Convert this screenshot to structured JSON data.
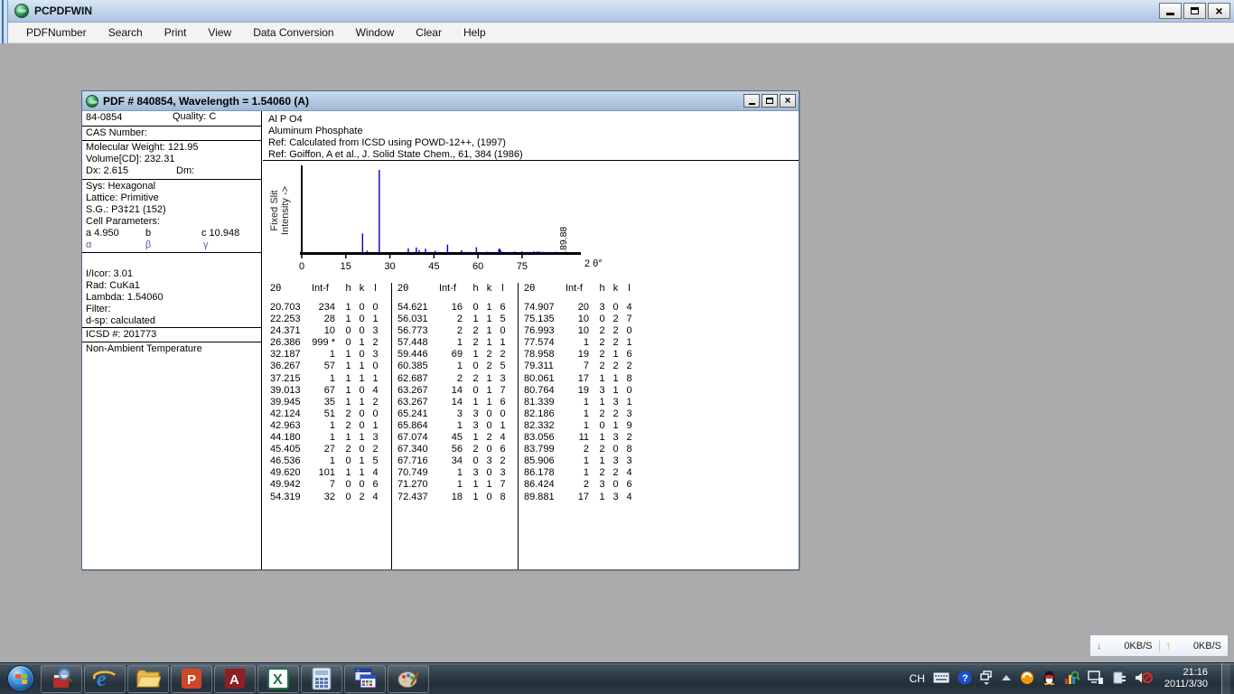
{
  "app": {
    "title": "PCPDFWIN",
    "menu": [
      "PDFNumber",
      "Search",
      "Print",
      "View",
      "Data Conversion",
      "Window",
      "Clear",
      "Help"
    ],
    "window_controls": [
      "minimize",
      "maximize",
      "close"
    ]
  },
  "card_window": {
    "title": "PDF # 840854,  Wavelength = 1.54060   (A)",
    "left_panel": {
      "pdf_number": "84-0854",
      "quality": "Quality: C",
      "cas": "CAS Number:",
      "molecular_weight": "Molecular Weight:   121.95",
      "volume": "Volume[CD]:    232.31",
      "dx": "Dx:  2.615",
      "dm": "Dm:",
      "sys": "Sys: Hexagonal",
      "lattice": "Lattice: Primitive",
      "sg": "S.G.: P3‡21 (152)",
      "cell_parameters": "Cell Parameters:",
      "a": "a  4.950",
      "b": "b",
      "c": "c  10.948",
      "alpha": "α",
      "beta": "β",
      "gamma": "γ",
      "i_icor": "I/Icor:   3.01",
      "rad": "Rad: CuKa1",
      "lambda": "Lambda: 1.54060",
      "filter": "Filter:",
      "d_sp": "d-sp: calculated",
      "icsd": "ICSD #:  201773",
      "note": "Non-Ambient Temperature"
    },
    "header_lines": [
      "Al P O4",
      "Aluminum Phosphate",
      "Ref:  Calculated from ICSD using POWD-12++, (1997)",
      "Ref: Goiffon, A et al., J. Solid State Chem., 61, 384 (1986)"
    ]
  },
  "chart_data": {
    "type": "bar",
    "title": "Powder diffraction stick pattern",
    "ylabel_line1": "Fixed  Slit",
    "ylabel_line2": "Intensity  ->",
    "xlabel": "2 θ°",
    "xticks": [
      0,
      15,
      30,
      45,
      60,
      75
    ],
    "xlim": [
      0,
      95
    ],
    "ylim": [
      0,
      999
    ],
    "annotation": "89.88",
    "peak_color": "#0000bb",
    "peaks": [
      [
        20.703,
        234
      ],
      [
        22.253,
        28
      ],
      [
        24.371,
        10
      ],
      [
        26.386,
        999
      ],
      [
        32.187,
        1
      ],
      [
        36.267,
        57
      ],
      [
        37.215,
        1
      ],
      [
        39.013,
        67
      ],
      [
        39.945,
        35
      ],
      [
        42.124,
        51
      ],
      [
        42.963,
        1
      ],
      [
        44.18,
        1
      ],
      [
        45.405,
        27
      ],
      [
        46.536,
        1
      ],
      [
        49.62,
        101
      ],
      [
        49.942,
        7
      ],
      [
        54.319,
        32
      ],
      [
        54.621,
        16
      ],
      [
        56.031,
        2
      ],
      [
        56.773,
        2
      ],
      [
        57.448,
        1
      ],
      [
        59.446,
        69
      ],
      [
        60.385,
        1
      ],
      [
        62.687,
        2
      ],
      [
        63.267,
        14
      ],
      [
        63.267,
        14
      ],
      [
        65.241,
        3
      ],
      [
        65.864,
        1
      ],
      [
        67.074,
        45
      ],
      [
        67.34,
        56
      ],
      [
        67.716,
        34
      ],
      [
        70.749,
        1
      ],
      [
        71.27,
        1
      ],
      [
        72.437,
        18
      ],
      [
        74.907,
        20
      ],
      [
        75.135,
        10
      ],
      [
        76.993,
        10
      ],
      [
        77.574,
        1
      ],
      [
        78.958,
        19
      ],
      [
        79.311,
        7
      ],
      [
        80.061,
        17
      ],
      [
        80.764,
        19
      ],
      [
        81.339,
        1
      ],
      [
        82.186,
        1
      ],
      [
        82.332,
        1
      ],
      [
        83.056,
        11
      ],
      [
        83.799,
        2
      ],
      [
        85.906,
        1
      ],
      [
        86.178,
        1
      ],
      [
        86.424,
        2
      ],
      [
        89.881,
        17
      ]
    ]
  },
  "table": {
    "headers": [
      "2θ",
      "Int-f",
      "h",
      "k",
      "l"
    ],
    "groups": [
      [
        [
          "20.703",
          "234",
          "1",
          "0",
          "0"
        ],
        [
          "22.253",
          "28",
          "1",
          "0",
          "1"
        ],
        [
          "24.371",
          "10",
          "0",
          "0",
          "3"
        ],
        [
          "26.386",
          "999 *",
          "0",
          "1",
          "2"
        ],
        [
          "32.187",
          "1",
          "1",
          "0",
          "3"
        ],
        [
          "36.267",
          "57",
          "1",
          "1",
          "0"
        ],
        [
          "37.215",
          "1",
          "1",
          "1",
          "1"
        ],
        [
          "39.013",
          "67",
          "1",
          "0",
          "4"
        ],
        [
          "39.945",
          "35",
          "1",
          "1",
          "2"
        ],
        [
          "42.124",
          "51",
          "2",
          "0",
          "0"
        ],
        [
          "42.963",
          "1",
          "2",
          "0",
          "1"
        ],
        [
          "44.180",
          "1",
          "1",
          "1",
          "3"
        ],
        [
          "45.405",
          "27",
          "2",
          "0",
          "2"
        ],
        [
          "46.536",
          "1",
          "0",
          "1",
          "5"
        ],
        [
          "49.620",
          "101",
          "1",
          "1",
          "4"
        ],
        [
          "49.942",
          "7",
          "0",
          "0",
          "6"
        ],
        [
          "54.319",
          "32",
          "0",
          "2",
          "4"
        ]
      ],
      [
        [
          "54.621",
          "16",
          "0",
          "1",
          "6"
        ],
        [
          "56.031",
          "2",
          "1",
          "1",
          "5"
        ],
        [
          "56.773",
          "2",
          "2",
          "1",
          "0"
        ],
        [
          "57.448",
          "1",
          "2",
          "1",
          "1"
        ],
        [
          "59.446",
          "69",
          "1",
          "2",
          "2"
        ],
        [
          "60.385",
          "1",
          "0",
          "2",
          "5"
        ],
        [
          "62.687",
          "2",
          "2",
          "1",
          "3"
        ],
        [
          "63.267",
          "14",
          "0",
          "1",
          "7"
        ],
        [
          "63.267",
          "14",
          "1",
          "1",
          "6"
        ],
        [
          "65.241",
          "3",
          "3",
          "0",
          "0"
        ],
        [
          "65.864",
          "1",
          "3",
          "0",
          "1"
        ],
        [
          "67.074",
          "45",
          "1",
          "2",
          "4"
        ],
        [
          "67.340",
          "56",
          "2",
          "0",
          "6"
        ],
        [
          "67.716",
          "34",
          "0",
          "3",
          "2"
        ],
        [
          "70.749",
          "1",
          "3",
          "0",
          "3"
        ],
        [
          "71.270",
          "1",
          "1",
          "1",
          "7"
        ],
        [
          "72.437",
          "18",
          "1",
          "0",
          "8"
        ]
      ],
      [
        [
          "74.907",
          "20",
          "3",
          "0",
          "4"
        ],
        [
          "75.135",
          "10",
          "0",
          "2",
          "7"
        ],
        [
          "76.993",
          "10",
          "2",
          "2",
          "0"
        ],
        [
          "77.574",
          "1",
          "2",
          "2",
          "1"
        ],
        [
          "78.958",
          "19",
          "2",
          "1",
          "6"
        ],
        [
          "79.311",
          "7",
          "2",
          "2",
          "2"
        ],
        [
          "80.061",
          "17",
          "1",
          "1",
          "8"
        ],
        [
          "80.764",
          "19",
          "3",
          "1",
          "0"
        ],
        [
          "81.339",
          "1",
          "1",
          "3",
          "1"
        ],
        [
          "82.186",
          "1",
          "2",
          "2",
          "3"
        ],
        [
          "82.332",
          "1",
          "0",
          "1",
          "9"
        ],
        [
          "83.056",
          "11",
          "1",
          "3",
          "2"
        ],
        [
          "83.799",
          "2",
          "2",
          "0",
          "8"
        ],
        [
          "85.906",
          "1",
          "1",
          "3",
          "3"
        ],
        [
          "86.178",
          "1",
          "2",
          "2",
          "4"
        ],
        [
          "86.424",
          "2",
          "3",
          "0",
          "6"
        ],
        [
          "89.881",
          "17",
          "1",
          "3",
          "4"
        ]
      ]
    ]
  },
  "net_widget": {
    "down": "0KB/S",
    "up": "0KB/S"
  },
  "taskbar": {
    "icons": [
      "start-button",
      "dictionary-icon",
      "internet-explorer-icon",
      "folder-icon",
      "powerpoint-icon",
      "adobe-reader-icon",
      "excel-icon",
      "calculator-icon",
      "pcpdfwin-taskbar-icon",
      "paint-icon"
    ]
  },
  "tray": {
    "lang": "CH",
    "icons": [
      "keyboard-icon",
      "help-icon",
      "window-restore-icon",
      "show-hidden-icons",
      "sogou-icon",
      "qq-icon",
      "stock-chart-icon",
      "network-icon",
      "device-plug-icon",
      "volume-muted-icon"
    ],
    "time": "21:16",
    "date": "2011/3/30"
  }
}
